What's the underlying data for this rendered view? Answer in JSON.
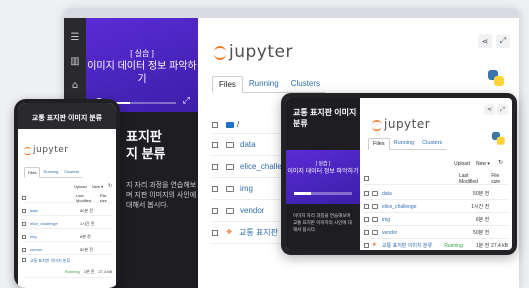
{
  "colors": {
    "accent_purple": "#4a24c2",
    "jupyter_orange": "#f37626",
    "link_blue": "#2f6fb0",
    "running_green": "#2e9c3e"
  },
  "course": {
    "tag": "[ 실습 ]",
    "video_title": "이미지 데이터 정보 파악하기",
    "big_title_line1": "표지판",
    "big_title_line2": "지 분류",
    "description": "지 자리 과정을 연습해보며 지판 이미지의 사인에 대해서 봅시다.",
    "progress_fraction": 0.3
  },
  "jupyter": {
    "logo_text": "jupyter",
    "tabs": [
      "Files",
      "Running",
      "Clusters"
    ],
    "breadcrumb": "/",
    "files": [
      {
        "name": "data",
        "type": "folder"
      },
      {
        "name": "elice_challenge",
        "type": "folder"
      },
      {
        "name": "img",
        "type": "folder"
      },
      {
        "name": "vendor",
        "type": "folder"
      },
      {
        "name": "교통 표지판 이미",
        "type": "notebook"
      }
    ]
  },
  "phone": {
    "title": "교통 표지판 이미지 분류",
    "logo_text": "jupyter",
    "tabs": [
      "Files",
      "Running",
      "Clusters"
    ],
    "upload": "Upload",
    "new": "New ▾",
    "col_modified": "Last Modified",
    "col_size": "File size",
    "files": [
      {
        "name": "data",
        "modified": "50분 전"
      },
      {
        "name": "elice_challenge",
        "modified": "1시간 전"
      },
      {
        "name": "img",
        "modified": "6분 전"
      },
      {
        "name": "vendor",
        "modified": "50분 전"
      },
      {
        "name": "교통 표지판 이미지 분류",
        "status": "Running",
        "modified": "1분 전",
        "size": "27.4 kB"
      }
    ]
  },
  "tablet": {
    "title": "교통 표지판 이미지 분류",
    "logo_text": "jupyter",
    "tag": "[ 실습 ]",
    "video_title": "이미지 데이터 정보 파악하기",
    "description": "이미지 자리 과정을 연습해보며 교통 표지판 이미지의 사인에 대해서 봅시다.",
    "tabs": [
      "Files",
      "Running",
      "Clusters"
    ],
    "upload": "Upload",
    "new": "New ▾",
    "col_modified": "Last Modified",
    "col_size": "File size",
    "files": [
      {
        "name": "data",
        "modified": "50분 전"
      },
      {
        "name": "elice_challenge",
        "modified": "1시간 전"
      },
      {
        "name": "img",
        "modified": "6분 전"
      },
      {
        "name": "vendor",
        "modified": "50분 전"
      },
      {
        "name": "교통 표지판 이미지 분류",
        "status": "Running",
        "modified": "1분 전",
        "size": "27.4 kB"
      }
    ]
  }
}
